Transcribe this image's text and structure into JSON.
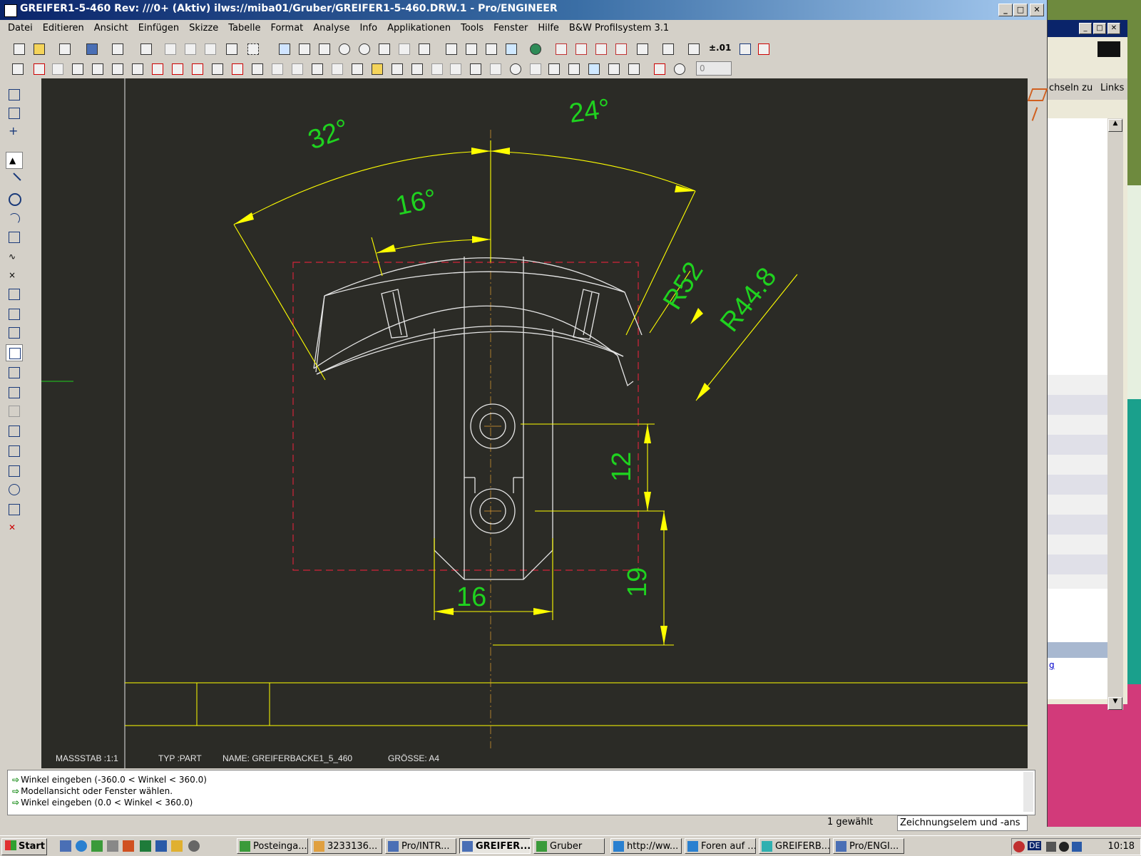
{
  "window": {
    "title": "GREIFER1-5-460 Rev: ///0+ (Aktiv) ilws://miba01/Gruber/GREIFER1-5-460.DRW.1 - Pro/ENGINEER",
    "minimize": "_",
    "maximize": "□",
    "close": "✕"
  },
  "menu": [
    "Datei",
    "Editieren",
    "Ansicht",
    "Einfügen",
    "Skizze",
    "Tabelle",
    "Format",
    "Analyse",
    "Info",
    "Applikationen",
    "Tools",
    "Fenster",
    "Hilfe",
    "B&W Profilsystem 3.1"
  ],
  "toolbar": {
    "tolerance_label": "±.01",
    "spinner_value": "0"
  },
  "drawing": {
    "dims": {
      "angle_32": "32°",
      "angle_24": "24°",
      "angle_16": "16°",
      "r52": "R52",
      "r448": "R44.8",
      "d12": "12",
      "d19": "19",
      "d16": "16"
    },
    "title_block": {
      "scale": "MASSSTAB :1:1",
      "type": "TYP :PART",
      "name": "NAME: GREIFERBACKE1_5_460",
      "size": "GRÖSSE: A4"
    },
    "colors": {
      "background": "#2b2b26",
      "geometry": "#e6e6e6",
      "dimension": "#ffff00",
      "text": "#1fd21f",
      "view_border": "#d4243a"
    }
  },
  "messages": [
    "Winkel eingeben (-360.0 < Winkel < 360.0)",
    "Modellansicht oder Fenster wählen.",
    "Winkel eingeben (0.0 < Winkel < 360.0)"
  ],
  "status": {
    "selected_count": "1 gewählt",
    "filter": "Zeichnungselem und -ans"
  },
  "bg_window": {
    "links_prefix": "chseln zu",
    "links": "Links",
    "link_fragment": "g"
  },
  "taskbar": {
    "start": "Start",
    "tasks": [
      "Posteinga...",
      "3233136...",
      "Pro/INTR...",
      "GREIFER...",
      "Gruber",
      "http://ww...",
      "Foren auf ...",
      "GREIFERB...",
      "Pro/ENGI..."
    ],
    "lang": "DE",
    "clock": "10:18"
  }
}
